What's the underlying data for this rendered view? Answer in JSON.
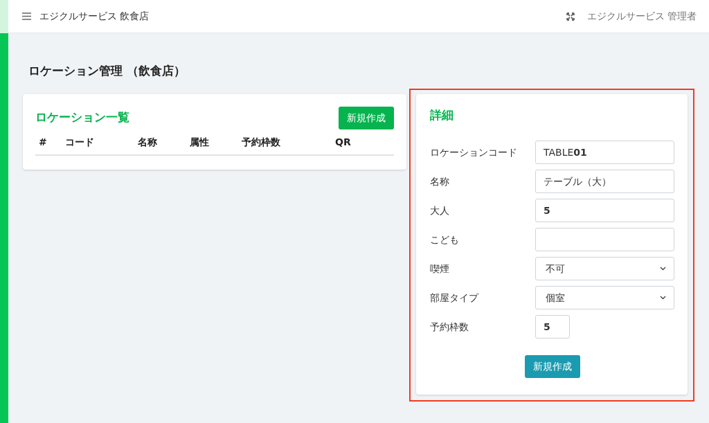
{
  "topbar": {
    "brand": "エジクルサービス 飲食店",
    "user": "エジクルサービス 管理者"
  },
  "page_title": "ロケーション管理 （飲食店）",
  "list_card": {
    "title": "ロケーション一覧",
    "new_button": "新規作成",
    "columns": [
      "#",
      "コード",
      "名称",
      "属性",
      "予約枠数",
      "QR"
    ]
  },
  "detail_card": {
    "title": "詳細",
    "highlighted": true,
    "fields": [
      {
        "kind": "text",
        "label": "ロケーションコード",
        "value": "TABLE**01**"
      },
      {
        "kind": "text",
        "label": "名称",
        "value": "テーブル（大）"
      },
      {
        "kind": "number",
        "label": "大人",
        "value": "5"
      },
      {
        "kind": "number",
        "label": "こども"
      },
      {
        "kind": "select",
        "label": "喫煙",
        "value": "不可"
      },
      {
        "kind": "select",
        "label": "部屋タイプ",
        "value": "個室"
      },
      {
        "kind": "short-number",
        "label": "予約枠数",
        "value": "5"
      }
    ],
    "submit_button": "新規作成"
  }
}
